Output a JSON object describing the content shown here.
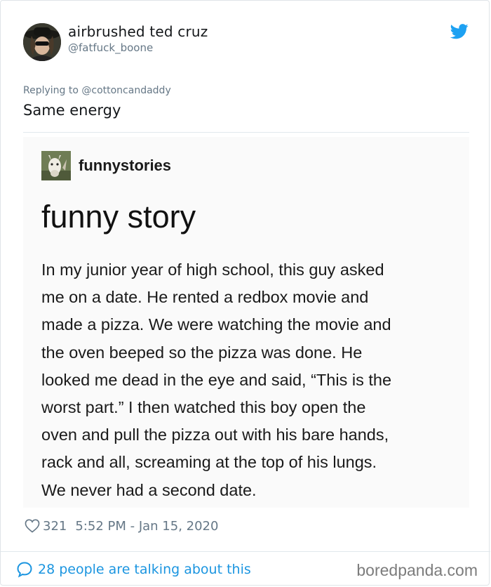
{
  "tweet": {
    "display_name": "airbrushed ted cruz",
    "handle": "@fatfuck_boone",
    "reply_to": "Replying to @cottoncandaddy",
    "text": "Same energy",
    "likes": "321",
    "timestamp": "5:52 PM - Jan 15, 2020",
    "talking": "28 people are talking about this",
    "brand_color": "#1da1f2"
  },
  "embedded_post": {
    "blog_name": "funnystories",
    "title": "funny story",
    "lines": [
      "In my junior year of high school, this guy asked",
      "me on a date. He rented a redbox movie and",
      "made a pizza. We were watching the movie and",
      "the oven beeped so the pizza was done. He",
      "looked me dead in the eye and said, “This is the",
      "worst part.” I then watched this boy open the",
      "oven and pull the pizza out with his bare hands,",
      "rack and all, screaming at the top of his lungs.",
      "We never had a second date."
    ]
  },
  "watermark": "boredpanda.com",
  "icons": [
    "avatar",
    "twitter-bird-icon",
    "llama-avatar",
    "heart-icon",
    "speech-bubble-icon"
  ]
}
